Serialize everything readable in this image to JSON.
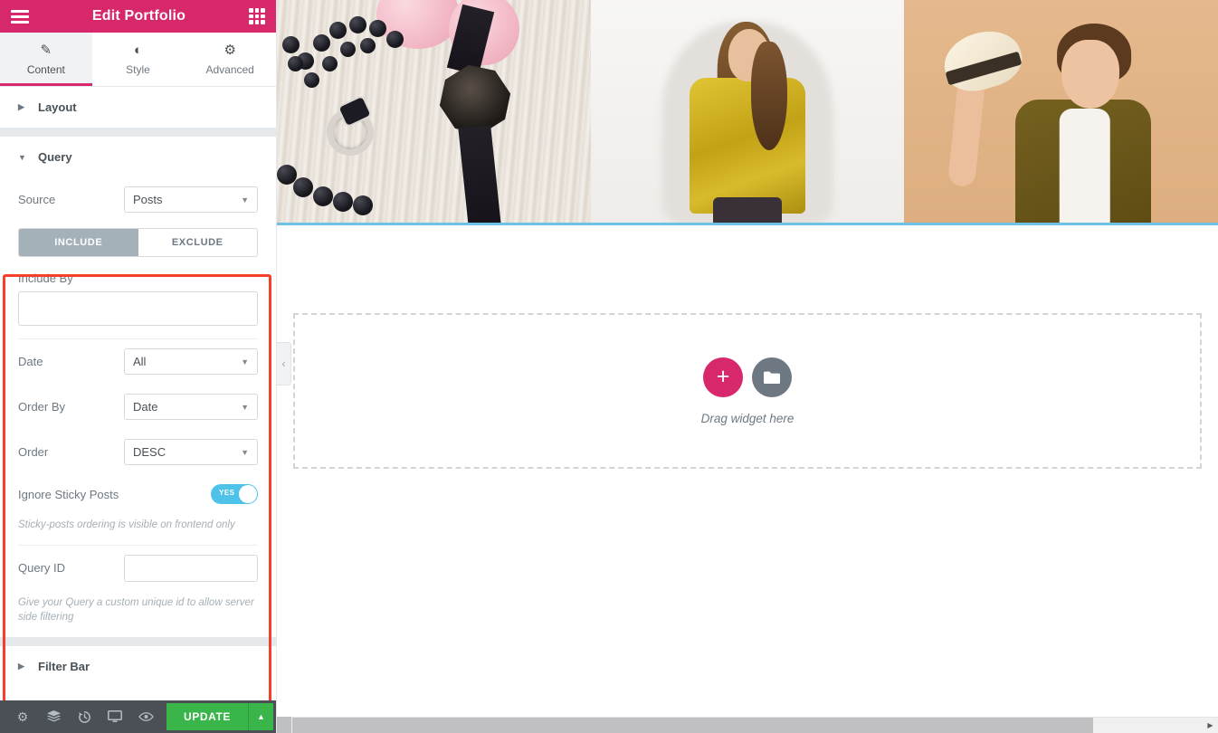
{
  "panel": {
    "header": {
      "title": "Edit Portfolio",
      "menu_icon": "hamburger-icon",
      "widgets_icon": "grid-icon"
    },
    "tabs": [
      {
        "label": "Content",
        "icon": "pencil-icon",
        "active": true
      },
      {
        "label": "Style",
        "icon": "contrast-circle-icon",
        "active": false
      },
      {
        "label": "Advanced",
        "icon": "gear-icon",
        "active": false
      }
    ],
    "sections": [
      {
        "label": "Layout",
        "expanded": false,
        "caret": "▶"
      },
      {
        "label": "Query",
        "expanded": true,
        "caret": "▼"
      },
      {
        "label": "Filter Bar",
        "expanded": false,
        "caret": "▶"
      }
    ],
    "query": {
      "source_label": "Source",
      "source_value": "Posts",
      "include_tab": "INCLUDE",
      "exclude_tab": "EXCLUDE",
      "include_by_label": "Include By",
      "include_by_value": "",
      "date_label": "Date",
      "date_value": "All",
      "order_by_label": "Order By",
      "order_by_value": "Date",
      "order_label": "Order",
      "order_value": "DESC",
      "ignore_sticky_label": "Ignore Sticky Posts",
      "ignore_sticky_state": "YES",
      "ignore_sticky_help": "Sticky-posts ordering is visible on frontend only",
      "query_id_label": "Query ID",
      "query_id_value": "",
      "query_id_help": "Give your Query a custom unique id to allow server side filtering"
    },
    "footer": {
      "icons": [
        {
          "name": "settings-gear-icon",
          "glyph": "⚙"
        },
        {
          "name": "navigator-layers-icon",
          "glyph": "≡"
        },
        {
          "name": "history-icon",
          "glyph": "↺"
        },
        {
          "name": "responsive-mode-icon",
          "glyph": "⬜"
        },
        {
          "name": "preview-eye-icon",
          "glyph": "◉"
        }
      ],
      "update_label": "UPDATE",
      "update_arrow": "▲"
    }
  },
  "canvas": {
    "collapse_arrow": "‹",
    "gallery": [
      {
        "name": "portfolio-image-jewelry",
        "alt": "Black bead necklace, silver ring and hexagonal watch with pink roses on white wood"
      },
      {
        "name": "portfolio-image-model",
        "alt": "Female model in gold sequin dress on white background"
      },
      {
        "name": "portfolio-image-man",
        "alt": "Smiling man in olive jacket holding a straw hat on tan background"
      }
    ],
    "dropzone": {
      "text": "Drag widget here",
      "add_glyph": "+",
      "folder_glyph": "▬"
    },
    "scroll": {
      "left_arrow": "◀",
      "right_arrow": "▶"
    }
  },
  "colors": {
    "brand_pink": "#d6286b",
    "update_green": "#39b54a",
    "toggle_blue": "#4ec2e8",
    "highlight_red": "#f4402a",
    "section_border_blue": "#6ec1e4",
    "toolbar_dark": "#4a5056"
  }
}
